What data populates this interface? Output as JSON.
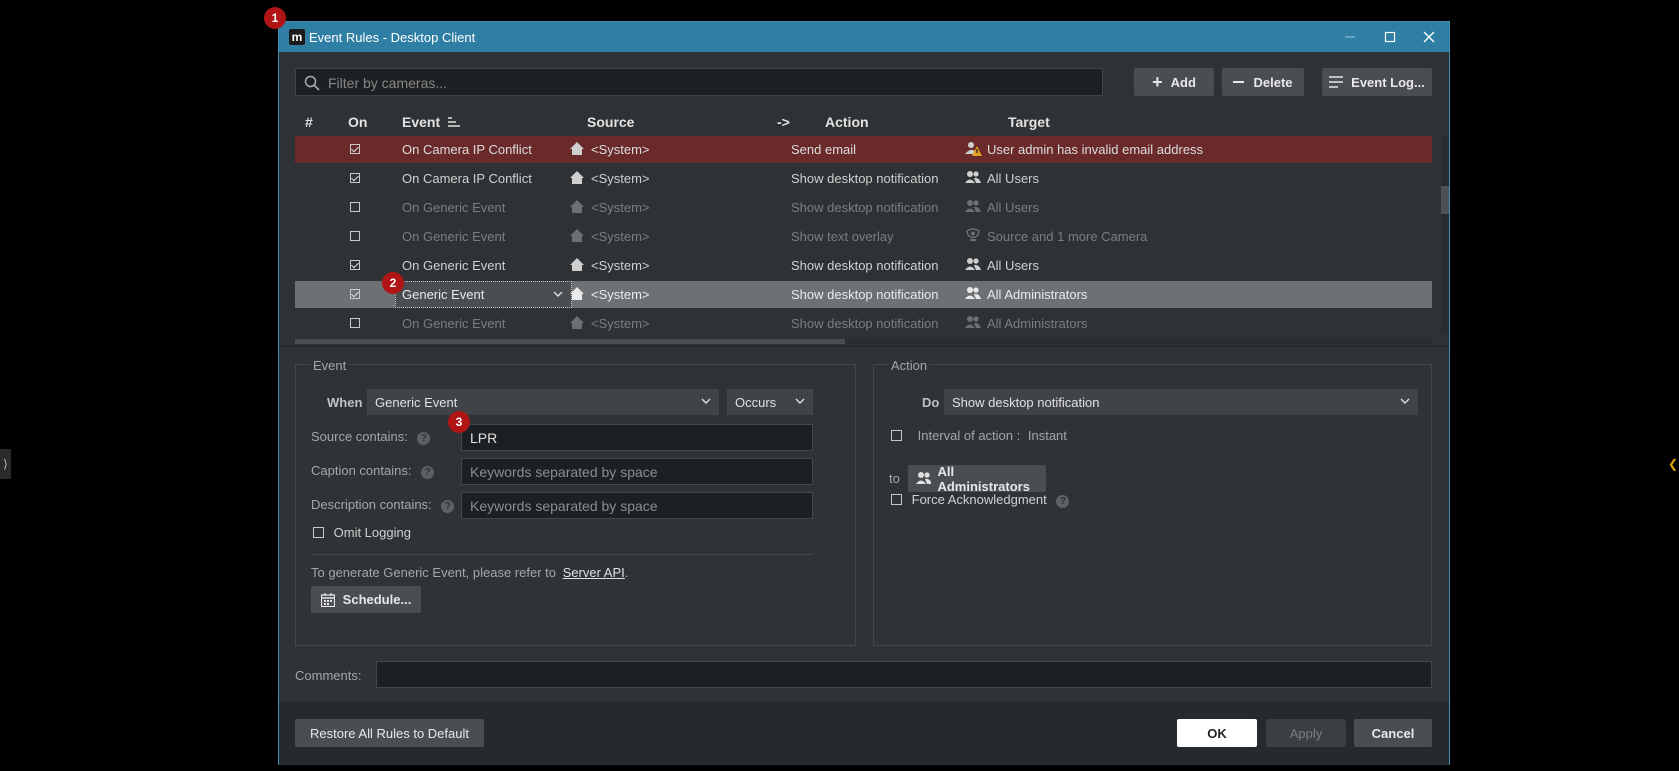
{
  "badges": [
    "1",
    "2",
    "3"
  ],
  "window": {
    "logo": "m",
    "title": "Event Rules - Desktop Client"
  },
  "toolbar": {
    "filter_placeholder": "Filter by cameras...",
    "add_label": "Add",
    "delete_label": "Delete",
    "event_log_label": "Event Log..."
  },
  "table": {
    "headers": {
      "num": "#",
      "on": "On",
      "event": "Event",
      "source": "Source",
      "arrow": "->",
      "action": "Action",
      "target": "Target"
    },
    "rows": [
      {
        "on": true,
        "event": "On Camera IP Conflict",
        "source": "<System>",
        "action": "Send email",
        "target": "User admin has invalid email address",
        "target_icon": "warning-user-icon",
        "state": "error"
      },
      {
        "on": true,
        "event": "On Camera IP Conflict",
        "source": "<System>",
        "action": "Show desktop notification",
        "target": "All Users",
        "target_icon": "users-icon",
        "state": "normal"
      },
      {
        "on": false,
        "event": "On Generic Event",
        "source": "<System>",
        "action": "Show desktop notification",
        "target": "All Users",
        "target_icon": "users-icon",
        "state": "disabled"
      },
      {
        "on": false,
        "event": "On Generic Event",
        "source": "<System>",
        "action": "Show text overlay",
        "target": "Source and 1 more Camera",
        "target_icon": "camera-icon",
        "state": "disabled"
      },
      {
        "on": true,
        "event": "On Generic Event",
        "source": "<System>",
        "action": "Show desktop notification",
        "target": "All Users",
        "target_icon": "users-icon",
        "state": "normal"
      },
      {
        "on": true,
        "event": "Generic Event",
        "source": "<System>",
        "action": "Show desktop notification",
        "target": "All Administrators",
        "target_icon": "users-icon",
        "state": "selected"
      },
      {
        "on": false,
        "event": "On Generic Event",
        "source": "<System>",
        "action": "Show desktop notification",
        "target": "All Administrators",
        "target_icon": "users-icon",
        "state": "disabled"
      }
    ]
  },
  "event_panel": {
    "title": "Event",
    "when_label": "When",
    "when_value": "Generic Event",
    "occurs_value": "Occurs",
    "source_label": "Source contains:",
    "source_value": "LPR",
    "caption_label": "Caption contains:",
    "caption_placeholder": "Keywords separated by space",
    "description_label": "Description contains:",
    "description_placeholder": "Keywords separated by space",
    "omit_logging_label": "Omit Logging",
    "info_text": "To generate Generic Event, please refer to",
    "info_link": "Server API",
    "info_end": ".",
    "schedule_label": "Schedule..."
  },
  "action_panel": {
    "title": "Action",
    "do_label": "Do",
    "do_value": "Show desktop notification",
    "interval_label": "Interval of action :",
    "interval_value": "Instant",
    "to_label": "to",
    "to_value": "All Administrators",
    "force_ack_label": "Force Acknowledgment"
  },
  "comments_label": "Comments:",
  "footer": {
    "restore_label": "Restore All Rules to Default",
    "ok_label": "OK",
    "apply_label": "Apply",
    "cancel_label": "Cancel"
  },
  "colors": {
    "titlebar": "#2f7fa5",
    "error_row": "#6b2a2a",
    "selected_row": "#6e7174",
    "badge": "#b01414"
  }
}
